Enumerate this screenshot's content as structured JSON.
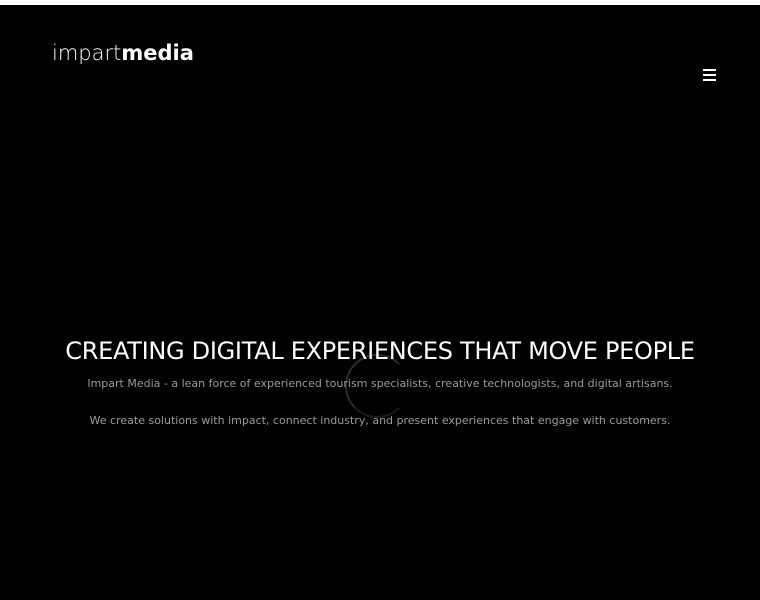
{
  "header": {
    "logo_light": "impart",
    "logo_bold": "media",
    "menu_icon": "hamburger-menu-icon"
  },
  "hero": {
    "title": "CREATING DIGITAL EXPERIENCES THAT MOVE PEOPLE",
    "line1": "Impart Media - a lean force of experienced tourism specialists, creative technologists, and digital artisans.",
    "line2": "We create solutions with impact, connect industry, and present experiences that engage with customers."
  },
  "colors": {
    "background": "#000000",
    "text": "#ffffff",
    "muted_text": "#9a9a9a"
  }
}
